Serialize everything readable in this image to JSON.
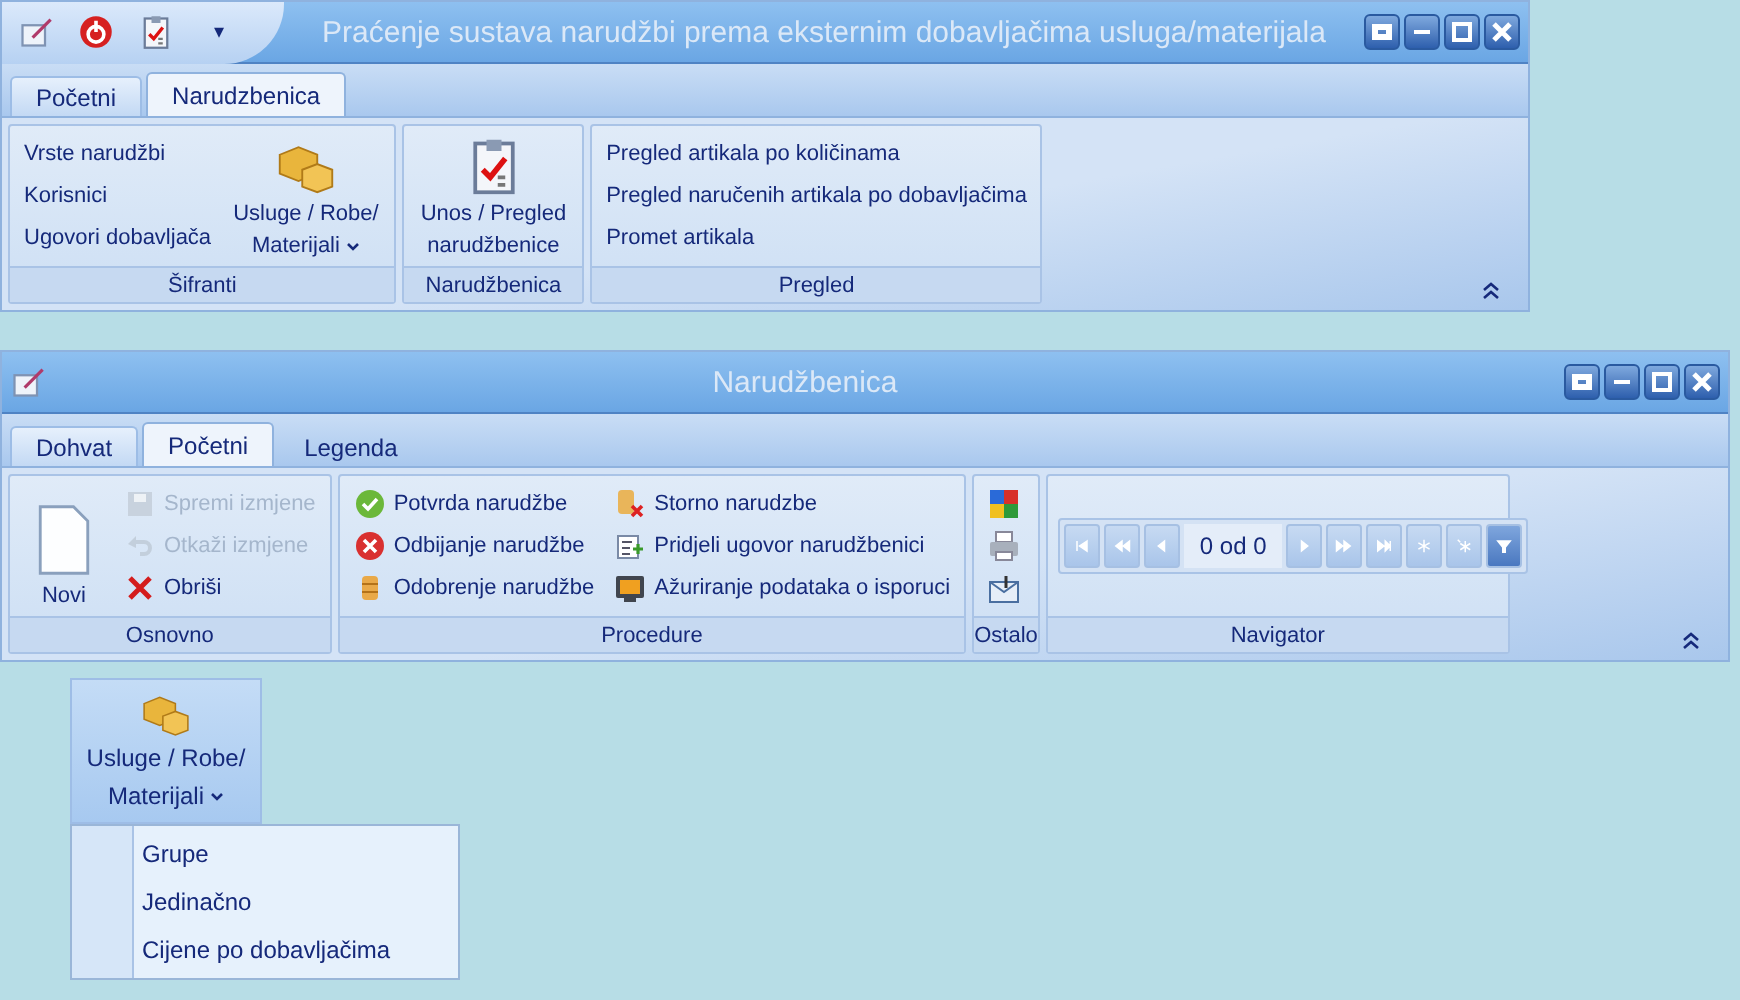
{
  "windows": [
    {
      "title": "Praćenje sustava narudžbi prema eksternim dobavljačima usluga/materijala",
      "quick_access": {
        "menu_caret": "▾"
      },
      "tabs": [
        {
          "label": "Početni",
          "selected": false
        },
        {
          "label": "Narudzbenica",
          "selected": true
        }
      ],
      "groups": [
        {
          "label": "Šifranti",
          "blocks": [
            {
              "kind": "column",
              "items": [
                {
                  "label": "Vrste narudžbi",
                  "disabled": false
                },
                {
                  "label": "Korisnici",
                  "disabled": false
                },
                {
                  "label": "Ugovori dobavljača",
                  "disabled": false
                }
              ]
            },
            {
              "kind": "large",
              "lines": [
                "Usluge / Robe/",
                "Materijali"
              ],
              "dropdown": true
            }
          ]
        },
        {
          "label": "Narudžbenica",
          "blocks": [
            {
              "kind": "large",
              "lines": [
                "Unos / Pregled",
                "narudžbenice"
              ],
              "dropdown": false
            }
          ]
        },
        {
          "label": "Pregled",
          "blocks": [
            {
              "kind": "column",
              "items": [
                {
                  "label": "Pregled artikala po količinama",
                  "disabled": false
                },
                {
                  "label": "Pregled naručenih artikala po dobavljačima",
                  "disabled": false
                },
                {
                  "label": "Promet artikala",
                  "disabled": false
                }
              ]
            }
          ]
        }
      ]
    },
    {
      "title": "Narudžbenica",
      "tabs": [
        {
          "label": "Dohvat",
          "selected": false
        },
        {
          "label": "Početni",
          "selected": true
        },
        {
          "label": "Legenda",
          "selected": false
        }
      ],
      "groups": [
        {
          "label": "Osnovno",
          "blocks": [
            {
              "kind": "large",
              "lines": [
                "Novi"
              ],
              "dropdown": false
            },
            {
              "kind": "column",
              "items": [
                {
                  "label": "Spremi izmjene",
                  "disabled": true
                },
                {
                  "label": "Otkaži izmjene",
                  "disabled": true
                },
                {
                  "label": "Obriši",
                  "disabled": false
                }
              ]
            }
          ]
        },
        {
          "label": "Procedure",
          "blocks": [
            {
              "kind": "column",
              "items": [
                {
                  "label": "Potvrda narudžbe",
                  "disabled": false
                },
                {
                  "label": "Odbijanje narudžbe",
                  "disabled": false
                },
                {
                  "label": "Odobrenje narudžbe",
                  "disabled": false
                }
              ]
            },
            {
              "kind": "column",
              "items": [
                {
                  "label": "Storno narudzbe",
                  "disabled": false
                },
                {
                  "label": "Pridjeli ugovor narudžbenici",
                  "disabled": false
                },
                {
                  "label": "Ažuriranje podataka o isporuci",
                  "disabled": false
                }
              ]
            }
          ]
        },
        {
          "label": "Ostalo",
          "blocks": [
            {
              "kind": "icons"
            }
          ]
        },
        {
          "label": "Navigator",
          "blocks": [
            {
              "kind": "navigator",
              "position": "0 od 0"
            }
          ]
        }
      ]
    }
  ],
  "dropdown_preview": {
    "button_lines": [
      "Usluge / Robe/",
      "Materijali"
    ],
    "menu": [
      {
        "label": "Grupe"
      },
      {
        "label": "Jedinačno"
      },
      {
        "label": "Cijene po dobavljačima"
      }
    ]
  }
}
